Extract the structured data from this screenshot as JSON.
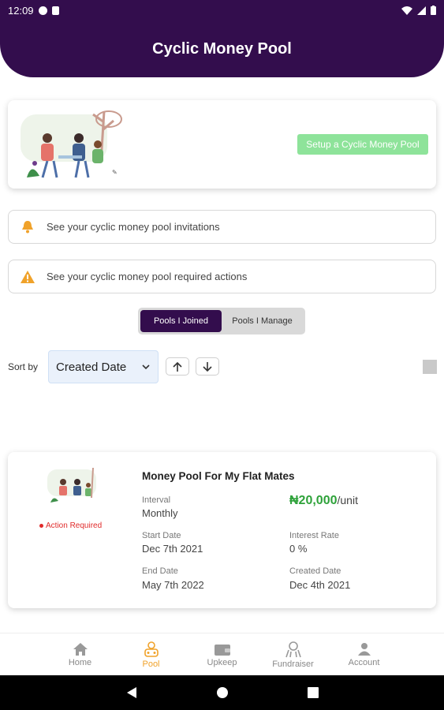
{
  "status_bar": {
    "time": "12:09"
  },
  "header": {
    "title": "Cyclic Money Pool"
  },
  "setup": {
    "button_label": "Setup a Cyclic Money Pool"
  },
  "notices": {
    "invitations": "See your cyclic money pool invitations",
    "actions": "See your cyclic money pool required actions"
  },
  "tabs": {
    "joined": "Pools I Joined",
    "manage": "Pools I Manage",
    "active": "joined"
  },
  "sort": {
    "label": "Sort by",
    "selected": "Created Date"
  },
  "pool": {
    "title": "Money Pool For My Flat Mates",
    "status": "Action Required",
    "interval_label": "Interval",
    "interval_value": "Monthly",
    "amount": "₦20,000",
    "amount_unit": "/unit",
    "start_label": "Start Date",
    "start_value": "Dec 7th 2021",
    "interest_label": "Interest Rate",
    "interest_value": "0 %",
    "end_label": "End Date",
    "end_value": "May 7th 2022",
    "created_label": "Created Date",
    "created_value": "Dec 4th 2021"
  },
  "bottom_nav": {
    "home": "Home",
    "pool": "Pool",
    "upkeep": "Upkeep",
    "fundraiser": "Fundraiser",
    "account": "Account",
    "active": "pool"
  },
  "colors": {
    "brand": "#330d4d",
    "accent": "#f0a22a",
    "success": "#2ea23a",
    "danger": "#e02a2a",
    "setup_button": "#8ee39a"
  }
}
